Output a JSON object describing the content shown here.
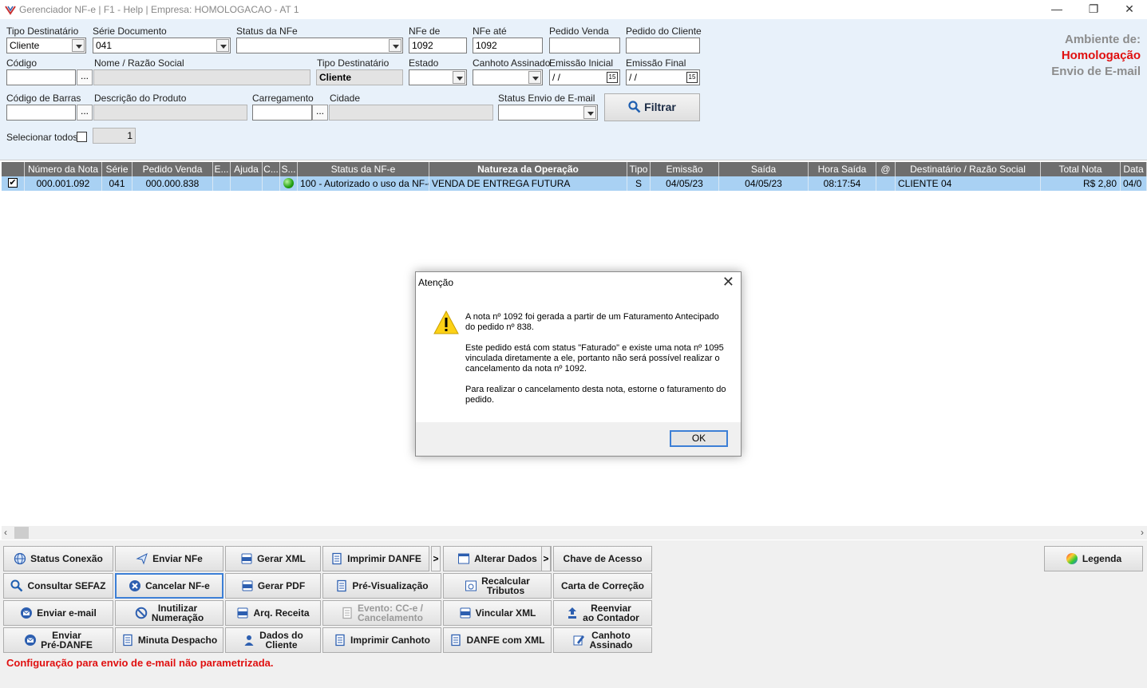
{
  "window": {
    "title": "Gerenciador NF-e | F1 - Help | Empresa: HOMOLOGACAO - AT 1",
    "minimize": "—",
    "restore": "❐",
    "close": "✕"
  },
  "filters": {
    "tipo_destinatario": {
      "label": "Tipo Destinatário",
      "value": "Cliente"
    },
    "serie_documento": {
      "label": "Série Documento",
      "value": "041"
    },
    "status_nfe": {
      "label": "Status da NFe",
      "value": ""
    },
    "nfe_de": {
      "label": "NFe de",
      "value": "1092"
    },
    "nfe_ate": {
      "label": "NFe até",
      "value": "1092"
    },
    "pedido_venda": {
      "label": "Pedido Venda",
      "value": ""
    },
    "pedido_cliente": {
      "label": "Pedido do Cliente",
      "value": ""
    },
    "codigo": {
      "label": "Código",
      "value": ""
    },
    "nome": {
      "label": "Nome / Razão Social",
      "value": ""
    },
    "tipo_destinatario2": {
      "label": "Tipo Destinatário",
      "value": "Cliente"
    },
    "estado": {
      "label": "Estado",
      "value": ""
    },
    "canhoto": {
      "label": "Canhoto Assinado",
      "value": ""
    },
    "emissao_inicial": {
      "label": "Emissão Inicial",
      "value": " / /"
    },
    "emissao_final": {
      "label": "Emissão Final",
      "value": " / /"
    },
    "codigo_barras": {
      "label": "Código de Barras",
      "value": ""
    },
    "descricao_produto": {
      "label": "Descrição do Produto",
      "value": ""
    },
    "carregamento": {
      "label": "Carregamento",
      "value": ""
    },
    "cidade": {
      "label": "Cidade",
      "value": ""
    },
    "status_email": {
      "label": "Status Envio de E-mail",
      "value": ""
    },
    "selecionar_todos": {
      "label": "Selecionar todos?",
      "count": "1"
    },
    "dots": "...",
    "cal_glyph": "15",
    "filtrar": "Filtrar"
  },
  "ambiente": {
    "line1": "Ambiente de:",
    "line2": "Homologação",
    "line3": "Envio de E-mail",
    "color_gray": "#8c8c8c",
    "color_red": "#e01010"
  },
  "grid": {
    "headers": [
      "",
      "Número da Nota",
      "Série",
      "Pedido Venda",
      "E...",
      "Ajuda",
      "C...",
      "S...",
      "Status da NF-e",
      "Natureza da Operação",
      "Tipo",
      "Emissão",
      "Saída",
      "Hora Saída",
      "@",
      "Destinatário / Razão Social",
      "Total Nota",
      "Data"
    ],
    "row": {
      "checked": true,
      "numero": "000.001.092",
      "serie": "041",
      "pedido": "000.000.838",
      "status": "100 - Autorizado o uso da NF-e",
      "natureza": "VENDA DE ENTREGA FUTURA",
      "tipo": "S",
      "emissao": "04/05/23",
      "saida": "04/05/23",
      "hora": "08:17:54",
      "destinatario": "CLIENTE 04",
      "total": "R$ 2,80",
      "data": "04/0"
    }
  },
  "buttons": {
    "status_conexao": "Status Conexão",
    "enviar_nfe": "Enviar NFe",
    "gerar_xml": "Gerar XML",
    "imprimir_danfe": "Imprimir DANFE",
    "alterar_dados": "Alterar Dados",
    "chave_acesso": "Chave de Acesso",
    "legenda": "Legenda",
    "consultar_sefaz": "Consultar SEFAZ",
    "cancelar_nfe": "Cancelar NF-e",
    "gerar_pdf": "Gerar PDF",
    "pre_visualizacao": "Pré-Visualização",
    "recalcular_1": "Recalcular",
    "recalcular_2": "Tributos",
    "carta_correcao": "Carta de Correção",
    "enviar_email": "Enviar e-mail",
    "inutilizar_1": "Inutilizar",
    "inutilizar_2": "Numeração",
    "arq_receita": "Arq. Receita",
    "evento_1": "Evento: CC-e /",
    "evento_2": "Cancelamento",
    "vincular_xml": "Vincular XML",
    "reenviar_1": "Reenviar",
    "reenviar_2": "ao Contador",
    "enviar_pre_1": "Enviar",
    "enviar_pre_2": "Pré-DANFE",
    "minuta": "Minuta Despacho",
    "dados_cliente_1": "Dados do",
    "dados_cliente_2": "Cliente",
    "imprimir_canhoto": "Imprimir Canhoto",
    "danfe_xml": "DANFE com XML",
    "canhoto_1": "Canhoto",
    "canhoto_2": "Assinado",
    "arrow": ">"
  },
  "status_message": "Configuração para envio de e-mail não parametrizada.",
  "dialog": {
    "title": "Atenção",
    "close": "✕",
    "p1": "A nota nº 1092 foi gerada a partir de um Faturamento Antecipado do pedido nº 838.",
    "p2": "Este pedido está com status \"Faturado\" e existe uma nota nº 1095 vinculada diretamente a ele, portanto não será possível realizar o cancelamento da nota nº 1092.",
    "p3": "Para realizar o cancelamento desta nota, estorne o faturamento do pedido.",
    "ok": "OK"
  }
}
